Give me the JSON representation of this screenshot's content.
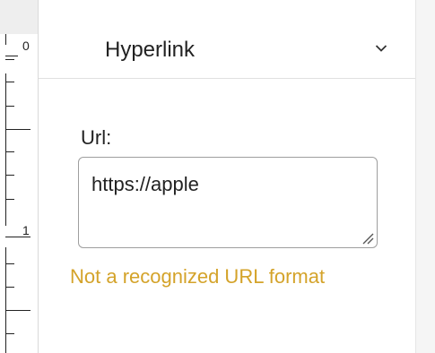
{
  "ruler": {
    "labels": [
      "0",
      "1"
    ]
  },
  "panel": {
    "title": "Hyperlink",
    "collapse_icon": "chevron-down-icon"
  },
  "url_field": {
    "label": "Url:",
    "value": "https://apple",
    "resize_icon": "resize-grip-icon"
  },
  "validation": {
    "message": "Not a recognized URL format",
    "color": "#d4a32a"
  }
}
